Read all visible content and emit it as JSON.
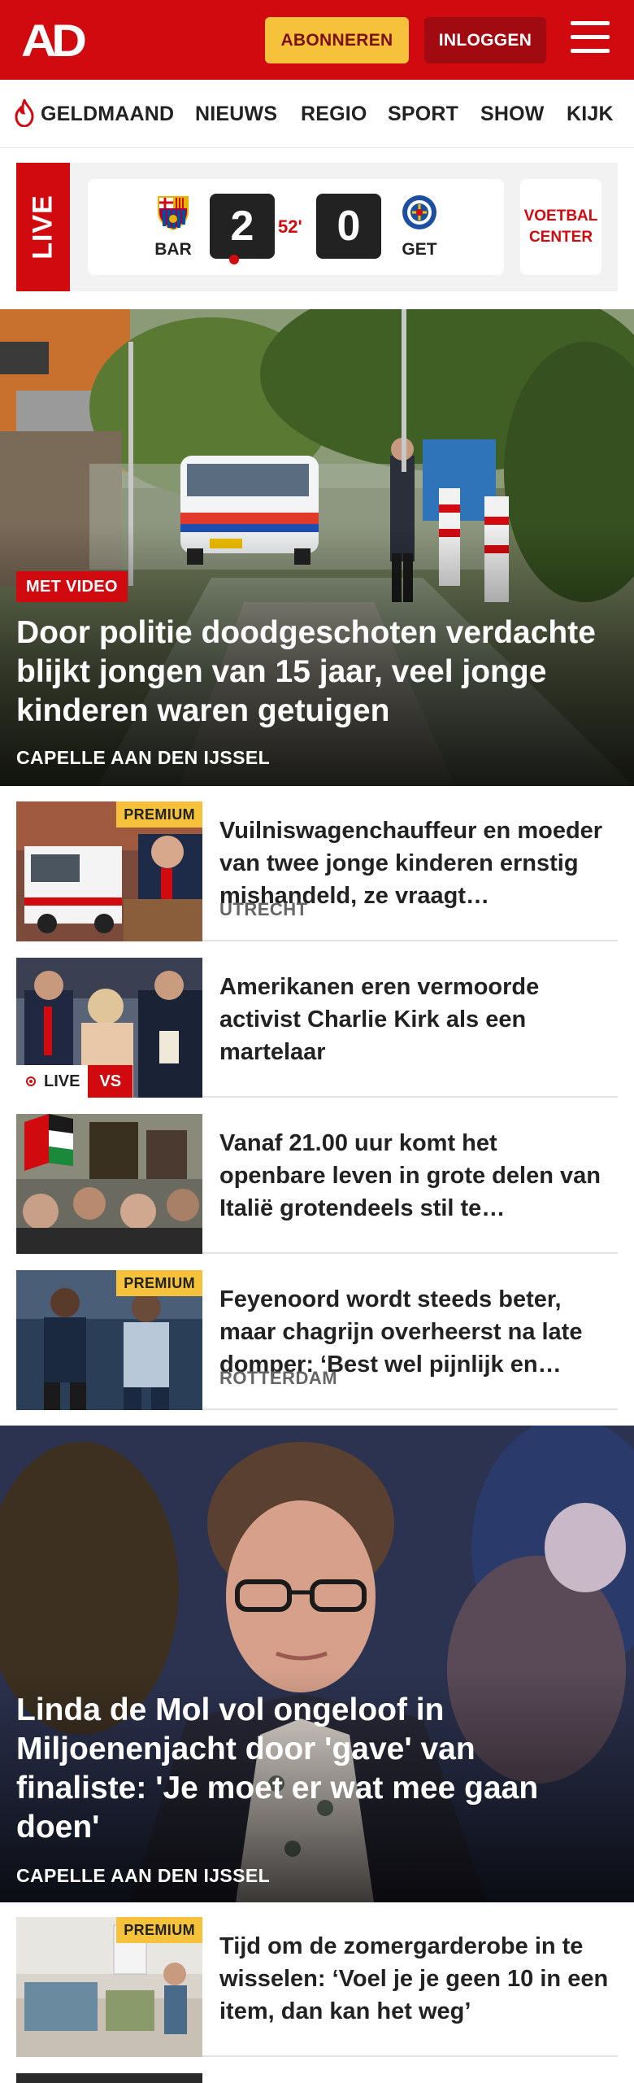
{
  "header": {
    "logo": "AD",
    "subscribe_label": "ABONNEREN",
    "login_label": "INLOGGEN"
  },
  "nav": {
    "items": [
      "GELDMAAND",
      "NIEUWS",
      "REGIO",
      "SPORT",
      "SHOW",
      "KIJK"
    ]
  },
  "live_score": {
    "live_label": "LIVE",
    "home_team": "BAR",
    "away_team": "GET",
    "home_score": "2",
    "away_score": "0",
    "minute": "52'",
    "center_label_1": "VOETBAL",
    "center_label_2": "CENTER"
  },
  "hero": {
    "tag": "MET VIDEO",
    "title": "Door politie doodgeschoten verdachte blijkt jongen van 15 jaar, veel jonge kinderen waren getuigen",
    "location": "CAPELLE AAN DEN IJSSEL"
  },
  "articles": [
    {
      "title": "Vuilniswagenchauffeur en moeder van twee jonge kinderen ernstig mishandeld, ze vraagt…",
      "location": "UTRECHT",
      "premium": "PREMIUM"
    },
    {
      "title": "Amerikanen eren vermoorde activist Charlie Kirk als een martelaar",
      "live": "LIVE",
      "vs": "VS"
    },
    {
      "title": "Vanaf 21.00 uur komt het openbare leven in grote delen van Italië grotendeels stil te…"
    },
    {
      "title": "Feyenoord wordt steeds beter, maar chagrijn overheerst na late domper: ‘Best wel pijnlijk en…",
      "location": "ROTTERDAM",
      "premium": "PREMIUM"
    }
  ],
  "hero2": {
    "title": "Linda de Mol vol ongeloof in Miljoenenjacht door 'gave' van finaliste: 'Je moet er wat mee gaan doen'",
    "location": "CAPELLE AAN DEN IJSSEL"
  },
  "articles2": [
    {
      "title": "Tijd om de zomergarderobe in te wisselen: ‘Voel je je geen 10 in een item, dan kan het weg’",
      "premium": "PREMIUM"
    }
  ],
  "colors": {
    "brand_red": "#d10a10",
    "premium_yellow": "#f6c23b",
    "login_dark_red": "#a10a10"
  }
}
